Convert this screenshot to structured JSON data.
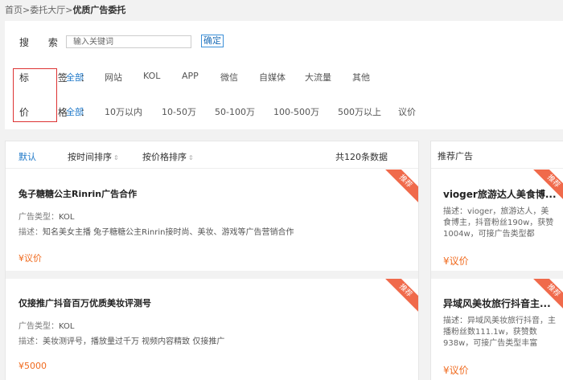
{
  "breadcrumb": {
    "home": "首页",
    "sep1": ">",
    "hall": "委托大厅",
    "sep2": ">",
    "current": "优质广告委托"
  },
  "search": {
    "label": "搜 索：",
    "placeholder": "输入关键词",
    "confirm_label": "确定"
  },
  "filters": {
    "tag_label": "标 签：",
    "tag_options": [
      "全部",
      "网站",
      "KOL",
      "APP",
      "微信",
      "自媒体",
      "大流量",
      "其他"
    ],
    "tag_selected": "全部",
    "price_label": "价 格：",
    "price_options": [
      "全部",
      "10万以内",
      "10-50万",
      "50-100万",
      "100-500万",
      "500万以上",
      "议价"
    ],
    "price_selected": "全部"
  },
  "sort_bar": {
    "default_label": "默认",
    "by_time_label": "按时间排序",
    "by_price_label": "按价格排序",
    "arrow": "⇕",
    "total": "共120条数据"
  },
  "listings": [
    {
      "title": "兔子糖糖公主Rinrin广告合作",
      "type_label": "广告类型：",
      "type_value": "KOL",
      "desc_label": "描述：",
      "desc_value": "知名美女主播 兔子糖糖公主Rinrin接时尚、美妆、游戏等广告营销合作",
      "price": "¥议价",
      "badge": "推荐"
    },
    {
      "title": "仅接推广抖音百万优质美妆评测号",
      "type_label": "广告类型：",
      "type_value": "KOL",
      "desc_label": "描述：",
      "desc_value": "美妆测评号，播放量过千万 视频内容精致 仅接推广",
      "price": "¥5000",
      "badge": "推荐"
    }
  ],
  "sidebar": {
    "header": "推荐广告",
    "items": [
      {
        "title": "vioger旅游达人美食博...",
        "desc": "描述：vioger，旅游达人，美食博主，抖音粉丝190w，获赞1004w，可接广告类型都",
        "price": "¥议价",
        "badge": "推荐"
      },
      {
        "title": "异域风美妆旅行抖音主...",
        "desc": "描述：异域风美妆旅行抖音，主播粉丝数111.1w，获赞数938w，可接广告类型丰富",
        "price": "¥议价",
        "badge": "推荐"
      }
    ]
  },
  "colors": {
    "accent_blue": "#1e78c8",
    "price_orange": "#f06a1e",
    "badge_red": "#f06a4b",
    "highlight_box_red": "#dd3333"
  }
}
